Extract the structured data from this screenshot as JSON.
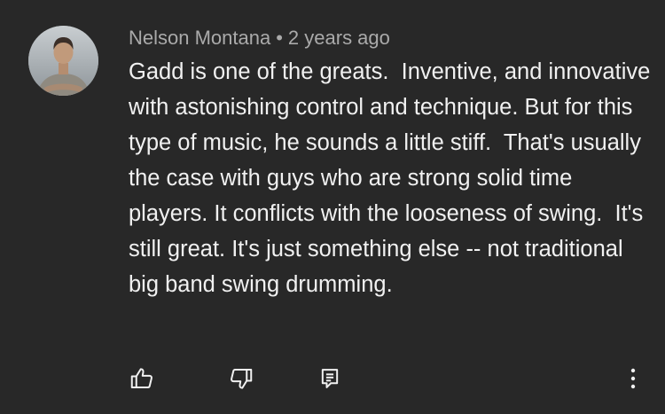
{
  "comment": {
    "author": "Nelson Montana",
    "separator": "•",
    "timestamp": "2 years ago",
    "text": "Gadd is one of the greats.  Inventive, and innovative  with astonishing control and technique. But for this type of music, he sounds a little stiff.  That's usually the case with guys who are strong solid time players. It conflicts with the looseness of swing.  It's still great. It's just something else -- not traditional big band swing drumming."
  },
  "actions": {
    "like_icon": "thumbs-up-icon",
    "dislike_icon": "thumbs-down-icon",
    "reply_icon": "reply-comment-icon",
    "more_icon": "more-vertical-icon"
  },
  "colors": {
    "background": "#282828",
    "text": "#f1f1f1",
    "meta": "#aaaaaa"
  }
}
